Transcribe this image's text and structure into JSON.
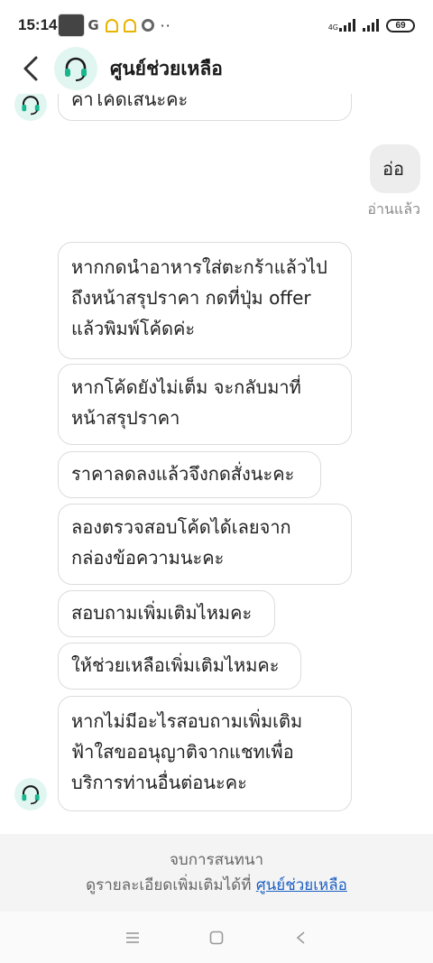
{
  "status_bar": {
    "time": "15:14",
    "network": "4G",
    "battery": "69"
  },
  "header": {
    "title": "ศูนย์ช่วยเหลือ"
  },
  "messages": {
    "m0": "ค่าโค้ดเสนะคะ",
    "m1": "อ่อ",
    "m1_status": "อ่านแล้ว",
    "m2": [
      "หากกดนำอาหารใส่ตะกร้าแล้วไป",
      "ถึงหน้าสรุปราคา กดที่ปุ่ม offer",
      "แล้วพิมพ์โค้ดค่ะ"
    ],
    "m3": [
      "หากโค้ดยังไม่เต็ม จะกลับมาที่",
      "หน้าสรุปราคา"
    ],
    "m4": "ราคาลดลงแล้วจึงกดสั่งนะคะ",
    "m5": [
      "ลองตรวจสอบโค้ดได้เลยจาก",
      "กล่องข้อความนะคะ"
    ],
    "m6": "สอบถามเพิ่มเติมไหมคะ",
    "m7": "ให้ช่วยเหลือเพิ่มเติมไหมคะ",
    "m8": [
      "หากไม่มีอะไรสอบถามเพิ่มเติม",
      "ฟ้าใสขออนุญาติจากแชทเพื่อ",
      "บริการท่านอื่นต่อนะคะ"
    ]
  },
  "footer": {
    "ended": "จบการสนทนา",
    "details": "ดูรายละเอียดเพิ่มเติมได้ที่",
    "link": "ศูนย์ช่วยเหลือ"
  },
  "colors": {
    "accent": "#18b78f",
    "link": "#1a5fc4",
    "my_bubble": "#ededed"
  },
  "icons": {
    "back": "chevron-left-icon",
    "agent": "headset-icon"
  }
}
